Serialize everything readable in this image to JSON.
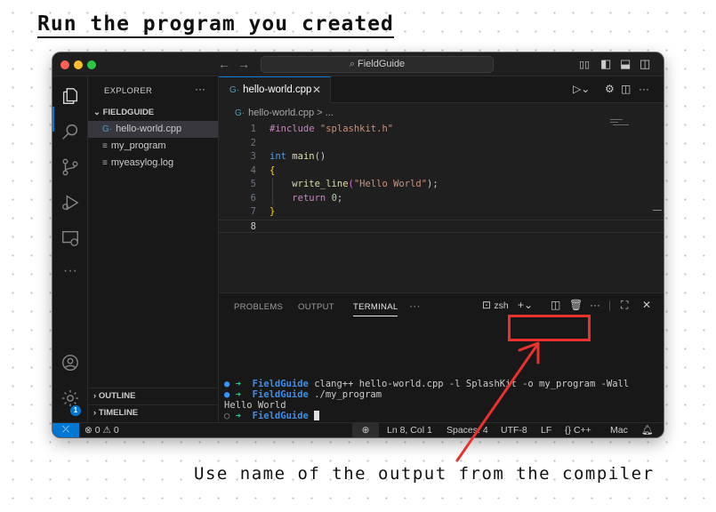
{
  "heading": "Run the program you created",
  "caption": "Use name of the output from the compiler",
  "colors": {
    "accent": "#0078d4",
    "annotation": "#e8322b",
    "traffic_red": "#ff5f57",
    "traffic_yellow": "#febc2e",
    "traffic_green": "#28c840"
  },
  "titlebar": {
    "search_text": "FieldGuide",
    "icons": [
      "back-arrow-icon",
      "forward-arrow-icon",
      "search-icon",
      "layout-icon",
      "toggle-sidebar-icon",
      "toggle-panel-icon",
      "toggle-secondary-sidebar-icon"
    ]
  },
  "activity_bar": {
    "items": [
      "explorer-icon",
      "search-icon",
      "source-control-icon",
      "run-debug-icon",
      "remote-explorer-icon",
      "more-icon",
      "account-icon",
      "settings-icon"
    ],
    "settings_badge": "1"
  },
  "sidebar": {
    "title": "EXPLORER",
    "more": "···",
    "folder": "FIELDGUIDE",
    "files": [
      {
        "name": "hello-world.cpp",
        "icon": "cpp-file-icon"
      },
      {
        "name": "my_program",
        "icon": "text-file-icon"
      },
      {
        "name": "myeasylog.log",
        "icon": "text-file-icon"
      }
    ],
    "outline": "OUTLINE",
    "timeline": "TIMELINE"
  },
  "editor": {
    "tab": {
      "label": "hello-world.cpp",
      "close": "✕"
    },
    "breadcrumb": [
      "hello-world.cpp",
      "..."
    ],
    "line_numbers": [
      "1",
      "2",
      "3",
      "4",
      "5",
      "6",
      "7",
      "8"
    ],
    "code": {
      "l1_pre": "#include",
      "l1_str": "\"splashkit.h\"",
      "l3_type": "int",
      "l3_fn": "main",
      "l3_parens": "()",
      "l4_brace": "{",
      "l5_fn": "write_line",
      "l5_open": "(",
      "l5_str": "\"Hello World\"",
      "l5_close": ");",
      "l6_ret": "return",
      "l6_num": "0",
      "l6_semi": ";",
      "l7_brace": "}"
    }
  },
  "panel": {
    "tabs": [
      "PROBLEMS",
      "OUTPUT",
      "TERMINAL",
      "···"
    ],
    "shell": "zsh",
    "terminal": {
      "prompt_dir": "FieldGuide",
      "cmd1": "clang++ hello-world.cpp -l SplashKit -o my_program -Wall",
      "cmd2": "./my_program",
      "output": "Hello World"
    }
  },
  "status_bar": {
    "errors": "0",
    "warnings": "0",
    "position": "Ln 8, Col 1",
    "spaces": "Spaces: 4",
    "encoding": "UTF-8",
    "eol": "LF",
    "language": "C++",
    "language_icon": "{}",
    "platform": "Mac"
  }
}
